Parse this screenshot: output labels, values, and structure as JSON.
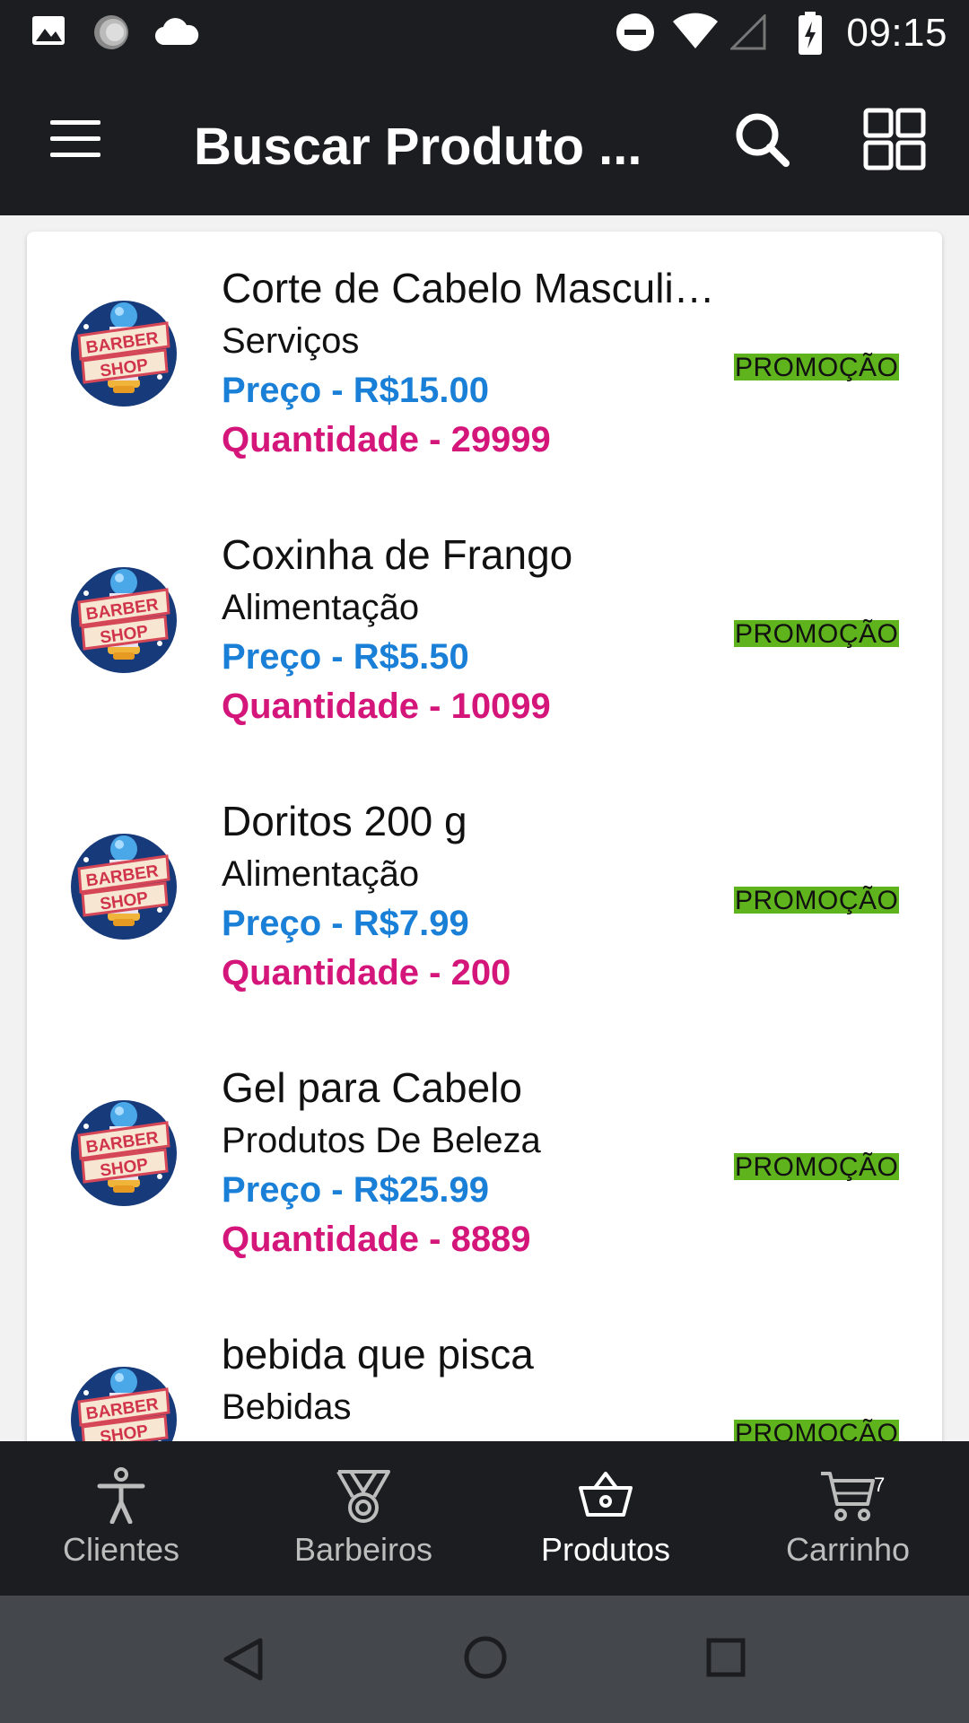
{
  "status_bar": {
    "time": "09:15",
    "icons": [
      "image-icon",
      "sync-icon",
      "cloud-icon",
      "do-not-disturb-icon",
      "wifi-icon",
      "cellular-icon",
      "battery-charging-icon"
    ]
  },
  "app_bar": {
    "title": "Buscar Produto ...",
    "icons": [
      "menu-icon",
      "search-icon",
      "grid-view-icon"
    ]
  },
  "products": [
    {
      "name": "Corte de Cabelo Masculi…",
      "category": "Serviços",
      "price": "Preço - R$15.00",
      "quantity": "Quantidade - 29999",
      "badge": "PROMOÇÃO"
    },
    {
      "name": "Coxinha de Frango",
      "category": "Alimentação",
      "price": "Preço - R$5.50",
      "quantity": "Quantidade - 10099",
      "badge": "PROMOÇÃO"
    },
    {
      "name": "Doritos 200 g",
      "category": "Alimentação",
      "price": "Preço - R$7.99",
      "quantity": "Quantidade - 200",
      "badge": "PROMOÇÃO"
    },
    {
      "name": "Gel para Cabelo",
      "category": "Produtos De Beleza",
      "price": "Preço - R$25.99",
      "quantity": "Quantidade - 8889",
      "badge": "PROMOÇÃO"
    },
    {
      "name": "bebida que pisca",
      "category": "Bebidas",
      "price": "",
      "quantity": "",
      "badge": "PROMOÇÃO"
    }
  ],
  "bottom_nav": {
    "items": [
      {
        "label": "Clientes",
        "icon": "person-icon"
      },
      {
        "label": "Barbeiros",
        "icon": "medal-icon"
      },
      {
        "label": "Produtos",
        "icon": "basket-icon"
      },
      {
        "label": "Carrinho",
        "icon": "cart-icon"
      }
    ],
    "active": "Produtos",
    "cart_badge": "7"
  },
  "logo_text": {
    "line1": "BARBER",
    "line2": "SHOP"
  },
  "colors": {
    "bar_bg": "#1c1d21",
    "price": "#1a7fd6",
    "quantity": "#d4157a",
    "promo_bg": "#5fb31d"
  }
}
